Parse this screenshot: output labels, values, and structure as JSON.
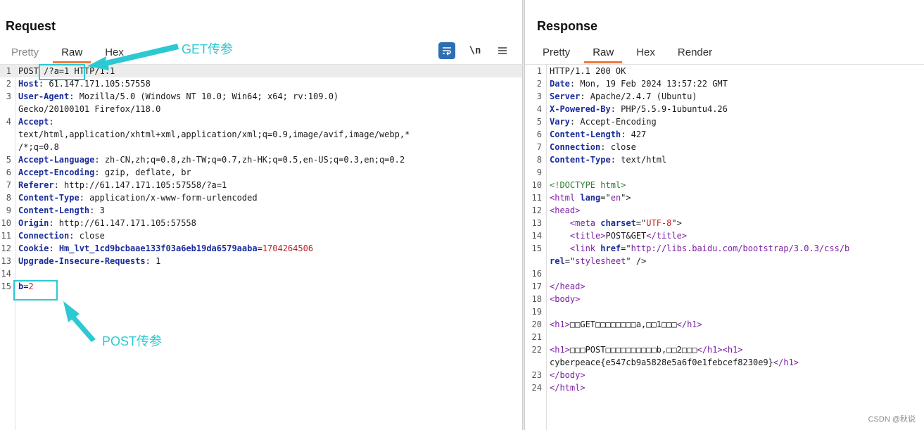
{
  "request": {
    "title": "Request",
    "tabs": [
      "Pretty",
      "Raw",
      "Hex"
    ],
    "active_tab": "Raw",
    "tools": {
      "wrap_icon": "wrap-text-icon",
      "newline_label": "\\n",
      "menu_icon": "hamburger-menu-icon"
    },
    "lines": [
      {
        "n": "1",
        "parts": [
          [
            "POST ",
            "plain"
          ],
          [
            "/?a=1",
            "plain"
          ],
          [
            " HTTP/1.1",
            "plain"
          ]
        ]
      },
      {
        "n": "2",
        "parts": [
          [
            "Host",
            "k"
          ],
          [
            ": 61.147.171.105:57558",
            "plain"
          ]
        ]
      },
      {
        "n": "3",
        "parts": [
          [
            "User-Agent",
            "k"
          ],
          [
            ": Mozilla/5.0 (Windows NT 10.0; Win64; x64; rv:109.0)",
            "plain"
          ]
        ]
      },
      {
        "n": "",
        "parts": [
          [
            "Gecko/20100101 Firefox/118.0",
            "plain"
          ]
        ]
      },
      {
        "n": "4",
        "parts": [
          [
            "Accept",
            "k"
          ],
          [
            ":",
            "plain"
          ]
        ]
      },
      {
        "n": "",
        "parts": [
          [
            "text/html,application/xhtml+xml,application/xml;q=0.9,image/avif,image/webp,*",
            "plain"
          ]
        ]
      },
      {
        "n": "",
        "parts": [
          [
            "/*;q=0.8",
            "plain"
          ]
        ]
      },
      {
        "n": "5",
        "parts": [
          [
            "Accept-Language",
            "k"
          ],
          [
            ": zh-CN,zh;q=0.8,zh-TW;q=0.7,zh-HK;q=0.5,en-US;q=0.3,en;q=0.2",
            "plain"
          ]
        ]
      },
      {
        "n": "6",
        "parts": [
          [
            "Accept-Encoding",
            "k"
          ],
          [
            ": gzip, deflate, br",
            "plain"
          ]
        ]
      },
      {
        "n": "7",
        "parts": [
          [
            "Referer",
            "k"
          ],
          [
            ": http://61.147.171.105:57558/?a=1",
            "plain"
          ]
        ]
      },
      {
        "n": "8",
        "parts": [
          [
            "Content-Type",
            "k"
          ],
          [
            ": application/x-www-form-urlencoded",
            "plain"
          ]
        ]
      },
      {
        "n": "9",
        "parts": [
          [
            "Content-Length",
            "k"
          ],
          [
            ": 3",
            "plain"
          ]
        ]
      },
      {
        "n": "10",
        "parts": [
          [
            "Origin",
            "k"
          ],
          [
            ": http://61.147.171.105:57558",
            "plain"
          ]
        ]
      },
      {
        "n": "11",
        "parts": [
          [
            "Connection",
            "k"
          ],
          [
            ": close",
            "plain"
          ]
        ]
      },
      {
        "n": "12",
        "parts": [
          [
            "Cookie",
            "k"
          ],
          [
            ": ",
            "plain"
          ],
          [
            "Hm_lvt_1cd9bcbaae133f03a6eb19da6579aaba",
            "k"
          ],
          [
            "=",
            "plain"
          ],
          [
            "1704264506",
            "red"
          ]
        ]
      },
      {
        "n": "13",
        "parts": [
          [
            "Upgrade-Insecure-Requests",
            "k"
          ],
          [
            ": 1",
            "plain"
          ]
        ]
      },
      {
        "n": "14",
        "parts": []
      },
      {
        "n": "15",
        "parts": [
          [
            "b",
            "k"
          ],
          [
            "=",
            "plain"
          ],
          [
            "2",
            "red"
          ]
        ]
      }
    ]
  },
  "response": {
    "title": "Response",
    "tabs": [
      "Pretty",
      "Raw",
      "Hex",
      "Render"
    ],
    "active_tab": "Raw",
    "lines": [
      {
        "n": "1",
        "parts": [
          [
            "HTTP/1.1 200 OK",
            "plain"
          ]
        ]
      },
      {
        "n": "2",
        "parts": [
          [
            "Date",
            "k"
          ],
          [
            ": Mon, 19 Feb 2024 13:57:22 GMT",
            "plain"
          ]
        ]
      },
      {
        "n": "3",
        "parts": [
          [
            "Server",
            "k"
          ],
          [
            ": Apache/2.4.7 (Ubuntu)",
            "plain"
          ]
        ]
      },
      {
        "n": "4",
        "parts": [
          [
            "X-Powered-By",
            "k"
          ],
          [
            ": PHP/5.5.9-1ubuntu4.26",
            "plain"
          ]
        ]
      },
      {
        "n": "5",
        "parts": [
          [
            "Vary",
            "k"
          ],
          [
            ": Accept-Encoding",
            "plain"
          ]
        ]
      },
      {
        "n": "6",
        "parts": [
          [
            "Content-Length",
            "k"
          ],
          [
            ": 427",
            "plain"
          ]
        ]
      },
      {
        "n": "7",
        "parts": [
          [
            "Connection",
            "k"
          ],
          [
            ": close",
            "plain"
          ]
        ]
      },
      {
        "n": "8",
        "parts": [
          [
            "Content-Type",
            "k"
          ],
          [
            ": text/html",
            "plain"
          ]
        ]
      },
      {
        "n": "9",
        "parts": []
      },
      {
        "n": "10",
        "parts": [
          [
            "<!DOCTYPE html>",
            "doct"
          ]
        ]
      },
      {
        "n": "11",
        "parts": [
          [
            "<html ",
            "tag"
          ],
          [
            "lang",
            "attr"
          ],
          [
            "=\"",
            "plain"
          ],
          [
            "en",
            "tag"
          ],
          [
            "\">",
            "plain"
          ]
        ]
      },
      {
        "n": "12",
        "parts": [
          [
            "<head>",
            "tag"
          ]
        ]
      },
      {
        "n": "13",
        "parts": [
          [
            "    <meta ",
            "tag"
          ],
          [
            "charset",
            "attr"
          ],
          [
            "=\"",
            "plain"
          ],
          [
            "UTF-8",
            "red"
          ],
          [
            "\">",
            "plain"
          ]
        ]
      },
      {
        "n": "14",
        "parts": [
          [
            "    <title>",
            "tag"
          ],
          [
            "POST&GET",
            "plain"
          ],
          [
            "</title>",
            "tag"
          ]
        ]
      },
      {
        "n": "15",
        "parts": [
          [
            "    <link ",
            "tag"
          ],
          [
            "href",
            "attr"
          ],
          [
            "=\"",
            "plain"
          ],
          [
            "http://libs.baidu.com/bootstrap/3.0.3/css/b",
            "tag"
          ]
        ]
      },
      {
        "n": "",
        "parts": [
          [
            "rel",
            "attr"
          ],
          [
            "=\"",
            "plain"
          ],
          [
            "stylesheet",
            "tag"
          ],
          [
            "\" />",
            "plain"
          ]
        ]
      },
      {
        "n": "16",
        "parts": []
      },
      {
        "n": "17",
        "parts": [
          [
            "</head>",
            "tag"
          ]
        ]
      },
      {
        "n": "18",
        "parts": [
          [
            "<body>",
            "tag"
          ]
        ]
      },
      {
        "n": "19",
        "parts": []
      },
      {
        "n": "20",
        "parts": [
          [
            "<h1>",
            "tag"
          ],
          [
            "□□GET□□□□□□□□a,□□1□□□",
            "plain"
          ],
          [
            "</h1>",
            "tag"
          ]
        ]
      },
      {
        "n": "21",
        "parts": []
      },
      {
        "n": "22",
        "parts": [
          [
            "<h1>",
            "tag"
          ],
          [
            "□□□POST□□□□□□□□□□b,□□2□□□",
            "plain"
          ],
          [
            "</h1>",
            "tag"
          ],
          [
            "<h1>",
            "tag"
          ]
        ]
      },
      {
        "n": "",
        "parts": [
          [
            "cyberpeace{e547cb9a5828e5a6f0e1febcef8230e9}",
            "plain"
          ],
          [
            "</h1>",
            "tag"
          ]
        ]
      },
      {
        "n": "23",
        "parts": [
          [
            "</body>",
            "tag"
          ]
        ]
      },
      {
        "n": "24",
        "parts": [
          [
            "</html>",
            "tag"
          ]
        ]
      }
    ]
  },
  "annotations": {
    "get_label": "GET传参",
    "post_label": "POST传参",
    "color": "#2cc9d2"
  },
  "watermark": "CSDN @秋说"
}
